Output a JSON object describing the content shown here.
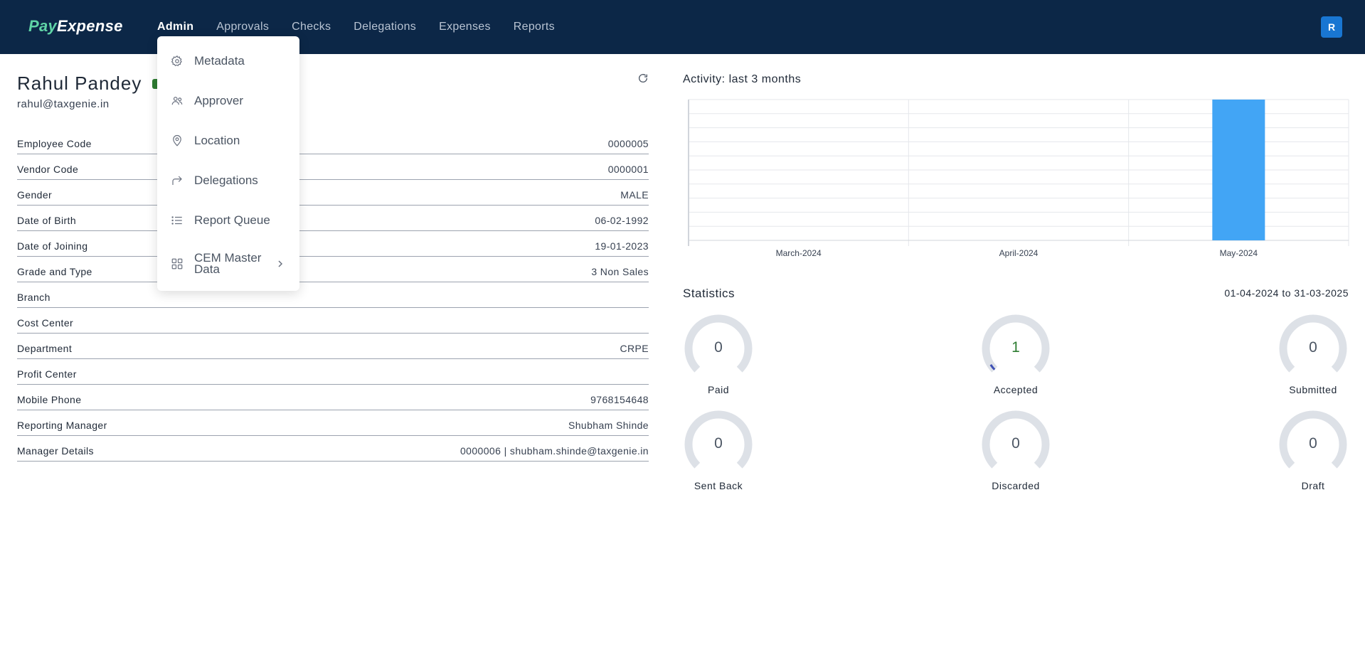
{
  "brand": {
    "pay": "Pay",
    "expense": "Expense"
  },
  "nav": [
    {
      "label": "Admin",
      "active": true
    },
    {
      "label": "Approvals"
    },
    {
      "label": "Checks"
    },
    {
      "label": "Delegations"
    },
    {
      "label": "Expenses"
    },
    {
      "label": "Reports"
    }
  ],
  "user": {
    "avatar_initial": "R",
    "name": "Rahul Pandey",
    "email": "rahul@taxgenie.in"
  },
  "admin_menu": [
    {
      "label": "Metadata",
      "icon": "gear-icon"
    },
    {
      "label": "Approver",
      "icon": "users-icon"
    },
    {
      "label": "Location",
      "icon": "location-pin-icon"
    },
    {
      "label": "Delegations",
      "icon": "forward-arrow-icon"
    },
    {
      "label": "Report Queue",
      "icon": "list-icon"
    },
    {
      "label": "CEM Master Data",
      "icon": "grid-icon",
      "has_submenu": true
    }
  ],
  "profile_rows": [
    {
      "label": "Employee Code",
      "value": "0000005"
    },
    {
      "label": "Vendor Code",
      "value": "0000001"
    },
    {
      "label": "Gender",
      "value": "MALE"
    },
    {
      "label": "Date of Birth",
      "value": "06-02-1992"
    },
    {
      "label": "Date of Joining",
      "value": "19-01-2023"
    },
    {
      "label": "Grade and Type",
      "value": "3 Non Sales"
    },
    {
      "label": "Branch",
      "value": ""
    },
    {
      "label": "Cost Center",
      "value": ""
    },
    {
      "label": "Department",
      "value": "CRPE"
    },
    {
      "label": "Profit Center",
      "value": ""
    },
    {
      "label": "Mobile Phone",
      "value": "9768154648"
    },
    {
      "label": "Reporting Manager",
      "value": "Shubham Shinde"
    },
    {
      "label": "Manager Details",
      "value": "0000006 | shubham.shinde@taxgenie.in"
    }
  ],
  "activity": {
    "title": "Activity: last 3 months"
  },
  "chart_data": {
    "type": "bar",
    "categories": [
      "March-2024",
      "April-2024",
      "May-2024"
    ],
    "values": [
      0,
      0,
      1
    ],
    "ylim": [
      0,
      1
    ],
    "grid": true,
    "color": "#42a5f5"
  },
  "statistics": {
    "title": "Statistics",
    "range": "01-04-2024 to 31-03-2025",
    "items": [
      {
        "label": "Paid",
        "value": "0"
      },
      {
        "label": "Accepted",
        "value": "1"
      },
      {
        "label": "Submitted",
        "value": "0"
      },
      {
        "label": "Sent Back",
        "value": "0"
      },
      {
        "label": "Discarded",
        "value": "0"
      },
      {
        "label": "Draft",
        "value": "0"
      }
    ]
  },
  "colors": {
    "nav_bg": "#0c2747",
    "accent": "#1976d2",
    "gauge_track": "#dde1e7",
    "gauge_fill": "#3f51b5",
    "verified": "#2e7d32"
  }
}
